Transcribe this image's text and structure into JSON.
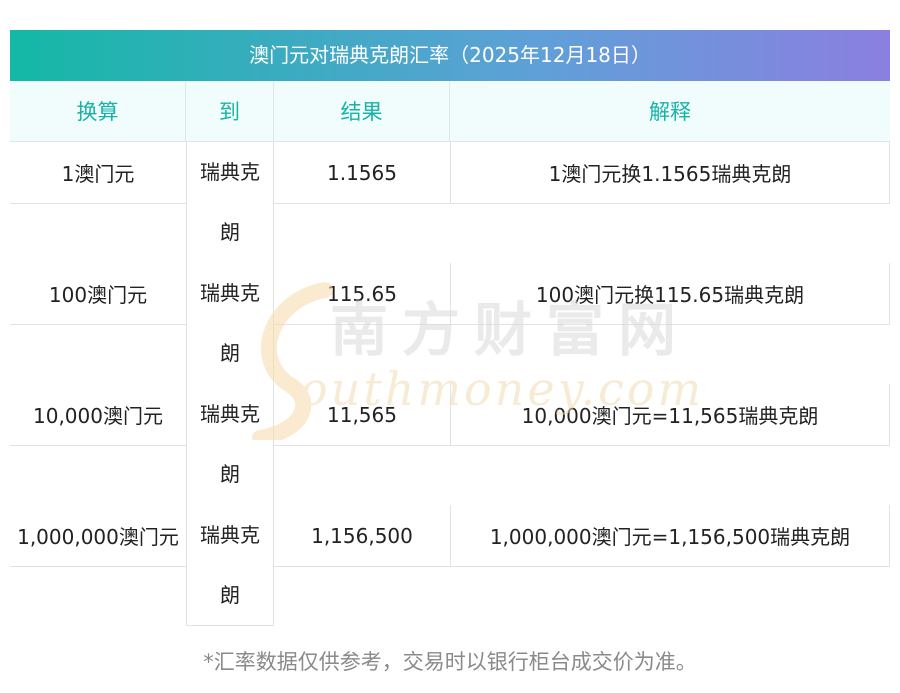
{
  "title": "澳门元对瑞典克朗汇率（2025年12月18日）",
  "headers": [
    "换算",
    "到",
    "结果",
    "解释"
  ],
  "rows": [
    {
      "amount": "1澳门元",
      "to_line1": "瑞典克",
      "to_line2": "朗",
      "result": "1.1565",
      "explanation": "1澳门元换1.1565瑞典克朗"
    },
    {
      "amount": "100澳门元",
      "to_line1": "瑞典克",
      "to_line2": "朗",
      "result": "115.65",
      "explanation": "100澳门元换115.65瑞典克朗"
    },
    {
      "amount": "10,000澳门元",
      "to_line1": "瑞典克",
      "to_line2": "朗",
      "result": "11,565",
      "explanation": "10,000澳门元=11,565瑞典克朗"
    },
    {
      "amount": "1,000,000澳门元",
      "to_line1": "瑞典克",
      "to_line2": "朗",
      "result": "1,156,500",
      "explanation": "1,000,000澳门元=1,156,500瑞典克朗"
    }
  ],
  "watermark": {
    "cn": "南方财富网",
    "en": "Southmoney.com"
  },
  "footnote": "*汇率数据仅供参考，交易时以银行柜台成交价为准。",
  "colors": {
    "header_text": "#17b3a7",
    "title_gradient_start": "#14b8a6",
    "title_gradient_end": "#8b7fe0"
  }
}
